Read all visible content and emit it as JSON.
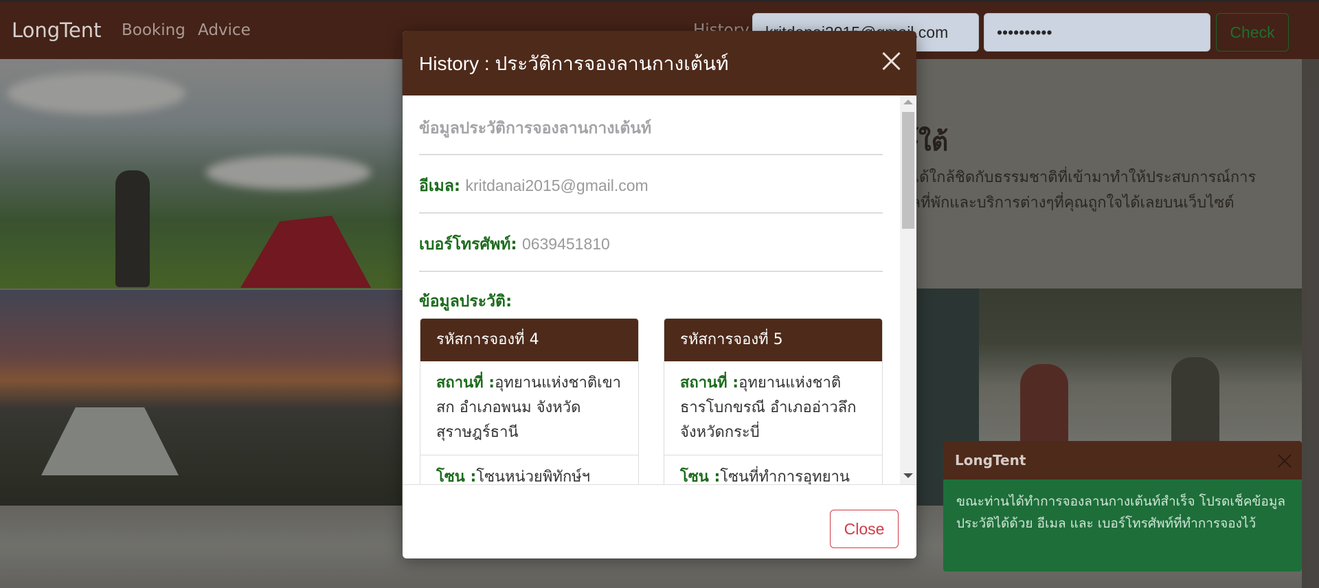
{
  "navbar": {
    "brand": "LongTent",
    "links": [
      "Booking",
      "Advice"
    ],
    "history_label": "History",
    "email_value": "kritdanai2015@gmail.com",
    "password_value": "••••••••••",
    "check_label": "Check"
  },
  "background": {
    "heading": "ษ์ใต้",
    "paragraph_line1": "นได้ใกล้ชิดกับธรรมชาติที่เข้ามาทำให้ประสบการณ์การ",
    "paragraph_line2": "มูลที่พักและบริการต่างๆที่คุณถูกใจได้เลยบนเว็บไซต์"
  },
  "modal": {
    "title": "History : ประวัติการจองลานกางเต้นท์",
    "section_title": "ข้อมูลประวัติการจองลานกางเต้นท์",
    "email_label": "อีเมล:",
    "email_value": "kritdanai2015@gmail.com",
    "phone_label": "เบอร์โทรศัพท์:",
    "phone_value": "0639451810",
    "history_label": "ข้อมูลประวัติ:",
    "cards": [
      {
        "header": "รหัสการจองที่ 4",
        "location_label": "สถานที่ :",
        "location_value": "อุทยานแห่งชาติเขาสก อำเภอพนม จังหวัดสุราษฎร์ธานี",
        "zone_label": "โซน :",
        "zone_value": "โซนหน่วยพิทักษ์ฯ"
      },
      {
        "header": "รหัสการจองที่ 5",
        "location_label": "สถานที่ :",
        "location_value": "อุทยานแห่งชาติธารโบกขรณี อำเภออ่าวลึก จังหวัดกระบี่",
        "zone_label": "โซน :",
        "zone_value": "โซนที่ทำการอุทยาน"
      }
    ],
    "close_label": "Close"
  },
  "toast": {
    "title": "LongTent",
    "message": "ขณะท่านได้ทำการจองลานกางเต้นท์สำเร็จ โปรดเช็คข้อมูลประวัติได้ด้วย อีเมล และ เบอร์โทรศัพท์ที่ทำการจองไว้"
  }
}
